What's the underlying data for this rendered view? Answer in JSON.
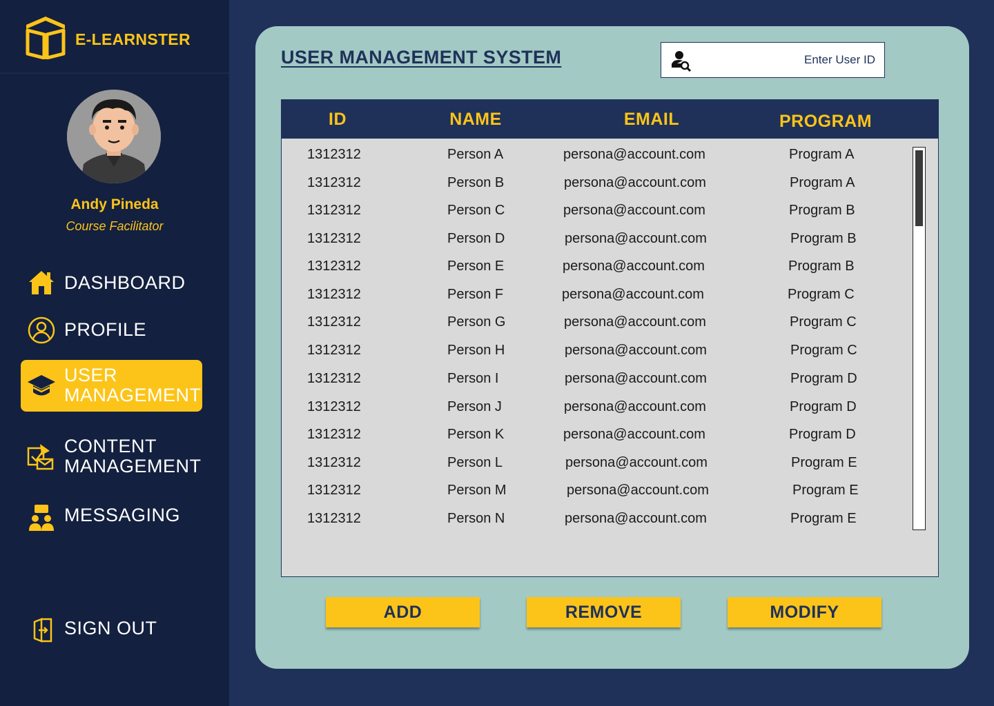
{
  "app": {
    "logo_text": "E-LEARNSTER"
  },
  "user": {
    "name": "Andy Pineda",
    "role": "Course Facilitator"
  },
  "nav": {
    "dashboard": "DASHBOARD",
    "profile": "PROFILE",
    "user_mgmt_line1": "USER",
    "user_mgmt_line2": "MANAGEMENT",
    "content_mgmt_line1": "CONTENT",
    "content_mgmt_line2": "MANAGEMENT",
    "messaging": "MESSAGING",
    "sign_out": "SIGN OUT",
    "active": "USER MANAGEMENT"
  },
  "page": {
    "title": "USER MANAGEMENT SYSTEM"
  },
  "search": {
    "placeholder": "Enter User ID"
  },
  "table": {
    "columns": [
      "ID",
      "NAME",
      "EMAIL",
      "PROGRAM"
    ],
    "rows": [
      [
        "1312312",
        "Person A",
        "persona@account.com",
        "Program A"
      ],
      [
        "1312312",
        "Person B",
        "persona@account.com",
        "Program A"
      ],
      [
        "1312312",
        "Person C",
        "persona@account.com",
        "Program B"
      ],
      [
        "1312312",
        "Person D",
        "persona@account.com",
        "Program B"
      ],
      [
        "1312312",
        "Person E",
        "persona@account.com",
        "Program B"
      ],
      [
        "1312312",
        "Person F",
        "persona@account.com",
        "Program C"
      ],
      [
        "1312312",
        "Person G",
        "persona@account.com",
        "Program C"
      ],
      [
        "1312312",
        "Person H",
        "persona@account.com",
        "Program C"
      ],
      [
        "1312312",
        "Person I",
        "persona@account.com",
        "Program D"
      ],
      [
        "1312312",
        "Person J",
        "persona@account.com",
        "Program D"
      ],
      [
        "1312312",
        "Person K",
        "persona@account.com",
        "Program D"
      ],
      [
        "1312312",
        "Person L",
        "persona@account.com",
        "Program E"
      ],
      [
        "1312312",
        "Person M",
        "persona@account.com",
        "Program E"
      ],
      [
        "1312312",
        "Person N",
        "persona@account.com",
        "Program E"
      ]
    ]
  },
  "actions": {
    "add": "ADD",
    "remove": "REMOVE",
    "modify": "MODIFY"
  },
  "colors": {
    "accent": "#fcc419",
    "navy": "#1f3159",
    "sidebar": "#13203f",
    "panel": "#a2c9c4",
    "table_body": "#d9d9d9"
  },
  "icons": {
    "logo": "open-book-icon",
    "dashboard": "home-icon",
    "profile": "user-circle-icon",
    "user_management": "graduation-cap-icon",
    "content_management": "content-envelope-icon",
    "messaging": "people-icon",
    "sign_out": "sign-out-icon",
    "search": "user-search-icon"
  }
}
